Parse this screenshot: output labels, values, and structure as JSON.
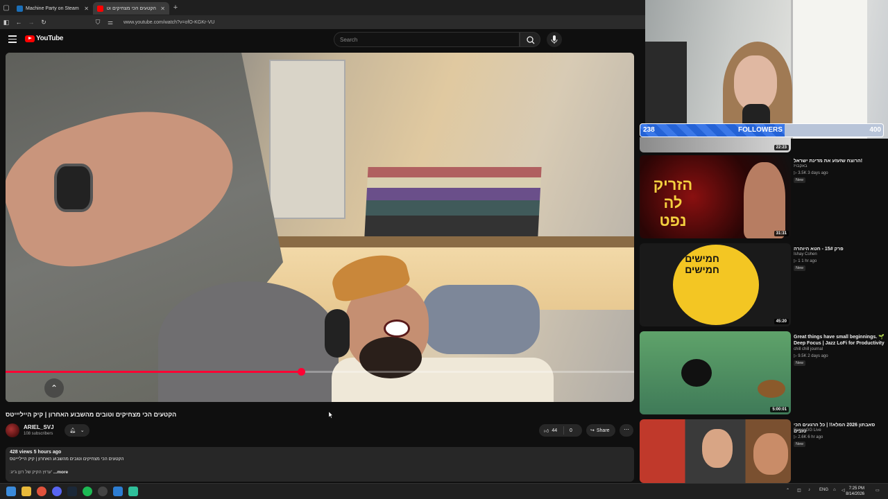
{
  "browser": {
    "tabs": [
      {
        "label": "Machine Party on Steam",
        "active": false
      },
      {
        "label": "הקטעים הכי מצחיקים וטובים מ",
        "active": true
      }
    ],
    "url": "www.youtube.com/watch?v=ofO-KGKr-VU"
  },
  "youtube": {
    "logo_text": "YouTube",
    "search_placeholder": "Search"
  },
  "video": {
    "title": "הקטעים הכי מצחיקים וטובים מהשבוע האחרון | קיק הייליייטס",
    "progress_fraction": 0.47,
    "channel": "ARIEL_SVJ",
    "subscribers": "108 subscribers",
    "likes": "44",
    "dislikes": "0",
    "share_label": "Share",
    "views_time": "428 views  5 hours ago",
    "desc_line1": "הקטעים הכי מצחיקים וטובים מהשבוע האחרון | קיק הייליייטס",
    "desc_line2": ":ערוץ הקיק של רוןן ג'יג'",
    "more_label": "...more"
  },
  "followers": {
    "current": "238",
    "label": "FOLLOWERS",
    "goal": "400",
    "fraction": 0.595
  },
  "sidebar": {
    "items": [
      {
        "title": "",
        "channel": "",
        "meta": "",
        "badge": "",
        "duration": "22:23"
      },
      {
        "title": "הרוצח שזעזע את מדינת ישראל!",
        "channel": "באקבויז",
        "meta": "▷ 3.5K  3 days ago",
        "badge": "New",
        "duration": "31:31",
        "thumb_text": "הזריק לה נפט"
      },
      {
        "title": "פרק 15# - חטא היוהרה",
        "channel": "Ishay Cohen",
        "meta": "▷ 1  1 hr ago",
        "badge": "New",
        "duration": "45:20",
        "thumb_text": "חמישים חמישים"
      },
      {
        "title": "Great things have small beginnings. 🌱 Deep Focus | Jazz LoFi for Productivity",
        "channel": "chill chill journal",
        "meta": "▷ 9.5K  2 days ago",
        "badge": "New",
        "duration": "5:00:01"
      },
      {
        "title": "סאבתון 2026 המלא!! | כל הרגעים הכי טובים",
        "channel": "RonenGG Live",
        "meta": "▷ 2.6K  6 hr ago",
        "badge": "New",
        "duration": ""
      }
    ]
  },
  "taskbar": {
    "lang": "ENG",
    "time": "7:25 PM",
    "date": "8/14/2026"
  },
  "colors": {
    "accent": "#ff0033",
    "follower_bar": "#2563d6"
  }
}
